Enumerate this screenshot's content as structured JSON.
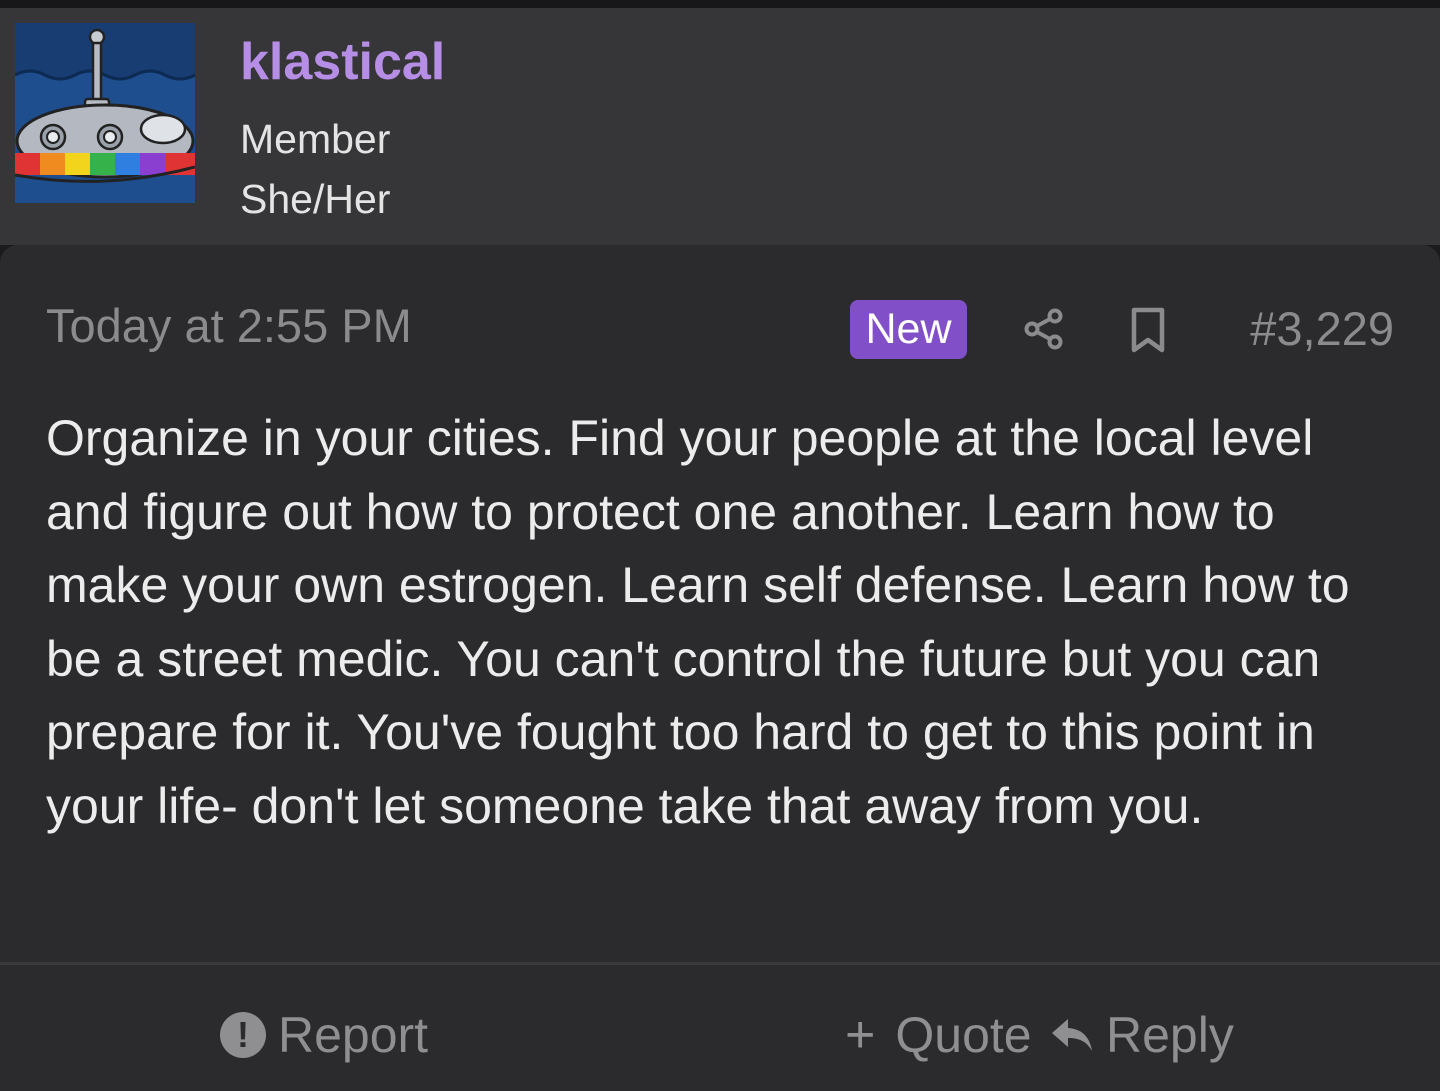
{
  "user": {
    "username": "klastical",
    "title": "Member",
    "pronouns": "She/Her"
  },
  "post": {
    "timestamp": "Today at 2:55 PM",
    "badge": "New",
    "number": "#3,229",
    "body": "Organize in your cities. Find your people at the local level and figure out how to protect one another. Learn how to make your own estrogen. Learn self defense. Learn how to be a street medic. You can't control the future but you can prepare for it. You've fought too hard to get to this point in your life- don't let someone take that away from you."
  },
  "actions": {
    "report": "Report",
    "quote": "Quote",
    "reply": "Reply"
  },
  "icons": {
    "share": "share-icon",
    "bookmark": "bookmark-icon",
    "report": "exclamation-circle-icon",
    "quote": "plus-icon",
    "reply": "reply-arrow-icon"
  },
  "colors": {
    "username": "#b78ee6",
    "badge": "#8150c8",
    "header_bg": "#363638",
    "card_bg": "#2b2b2d",
    "muted_text": "#8b8b8d"
  }
}
